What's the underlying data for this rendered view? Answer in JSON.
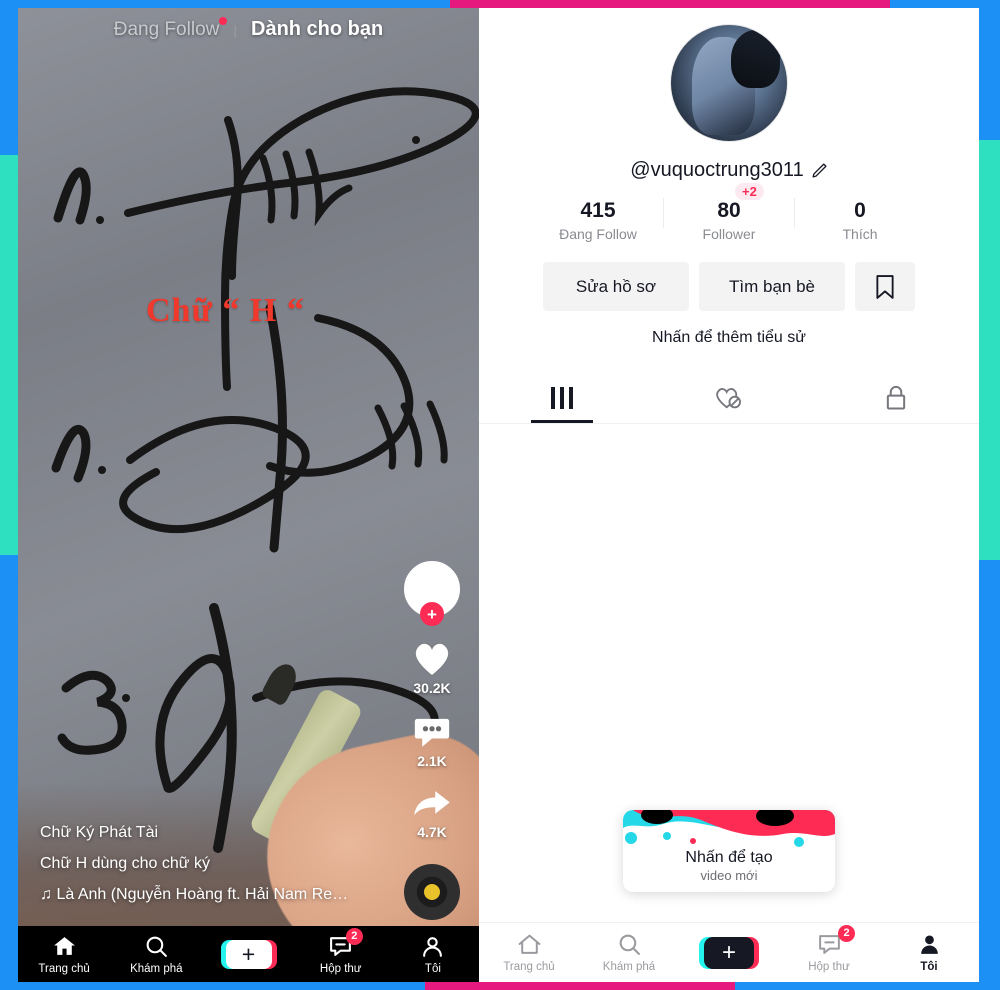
{
  "frame": {
    "colors": {
      "blue": "#1d90f5",
      "pink": "#e6197f",
      "teal": "#2ee0c0"
    }
  },
  "feed": {
    "tabs": [
      {
        "label": "Đang Follow",
        "active": false,
        "dot": true
      },
      {
        "label": "Dành cho bạn",
        "active": true,
        "dot": false
      }
    ],
    "overlay_text": "Chữ “ H “",
    "rail": {
      "avatar_icon": "profile-avatar",
      "follow_plus": "+",
      "like": {
        "icon": "heart-icon",
        "count": "30.2K"
      },
      "comment": {
        "icon": "comment-icon",
        "count": "2.1K"
      },
      "share": {
        "icon": "share-arrow-icon",
        "count": "4.7K"
      },
      "music_disc": "music-disc-icon"
    },
    "caption": {
      "author": "Chữ Ký Phát Tài",
      "description": "Chữ H dùng cho chữ ký",
      "music_note": "♫",
      "music": "Là Anh (Nguyễn Hoàng ft. Hải Nam Re…"
    },
    "nav": [
      {
        "label": "Trang chủ",
        "icon": "home-icon",
        "active": true,
        "badge": ""
      },
      {
        "label": "Khám phá",
        "icon": "search-icon",
        "active": false,
        "badge": ""
      },
      {
        "label": "",
        "icon": "plus-create-icon",
        "active": false,
        "badge": ""
      },
      {
        "label": "Hộp thư",
        "icon": "inbox-icon",
        "active": false,
        "badge": "2"
      },
      {
        "label": "Tôi",
        "icon": "person-icon",
        "active": false,
        "badge": ""
      }
    ]
  },
  "profile": {
    "avatar_icon": "profile-avatar",
    "handle": "@vuquoctrung3011",
    "edit_icon": "pencil-icon",
    "stats": [
      {
        "value": "415",
        "label": "Đang Follow",
        "badge": ""
      },
      {
        "value": "80",
        "label": "Follower",
        "badge": "+2"
      },
      {
        "value": "0",
        "label": "Thích",
        "badge": ""
      }
    ],
    "actions": {
      "edit_profile": "Sửa hồ sơ",
      "find_friends": "Tìm bạn bè",
      "bookmark_icon": "bookmark-icon"
    },
    "bio_prompt": "Nhấn để thêm tiểu sử",
    "tabs": [
      {
        "icon": "grid-posts-icon",
        "active": true
      },
      {
        "icon": "heart-hidden-icon",
        "active": false
      },
      {
        "icon": "lock-private-icon",
        "active": false
      }
    ],
    "tooltip": {
      "line1": "Nhấn để tạo",
      "line2": "video mới"
    },
    "nav": [
      {
        "label": "Trang chủ",
        "icon": "home-icon",
        "active": false,
        "badge": ""
      },
      {
        "label": "Khám phá",
        "icon": "search-icon",
        "active": false,
        "badge": ""
      },
      {
        "label": "",
        "icon": "plus-create-icon",
        "active": false,
        "badge": ""
      },
      {
        "label": "Hộp thư",
        "icon": "inbox-icon",
        "active": false,
        "badge": "2"
      },
      {
        "label": "Tôi",
        "icon": "person-icon",
        "active": true,
        "badge": ""
      }
    ]
  }
}
